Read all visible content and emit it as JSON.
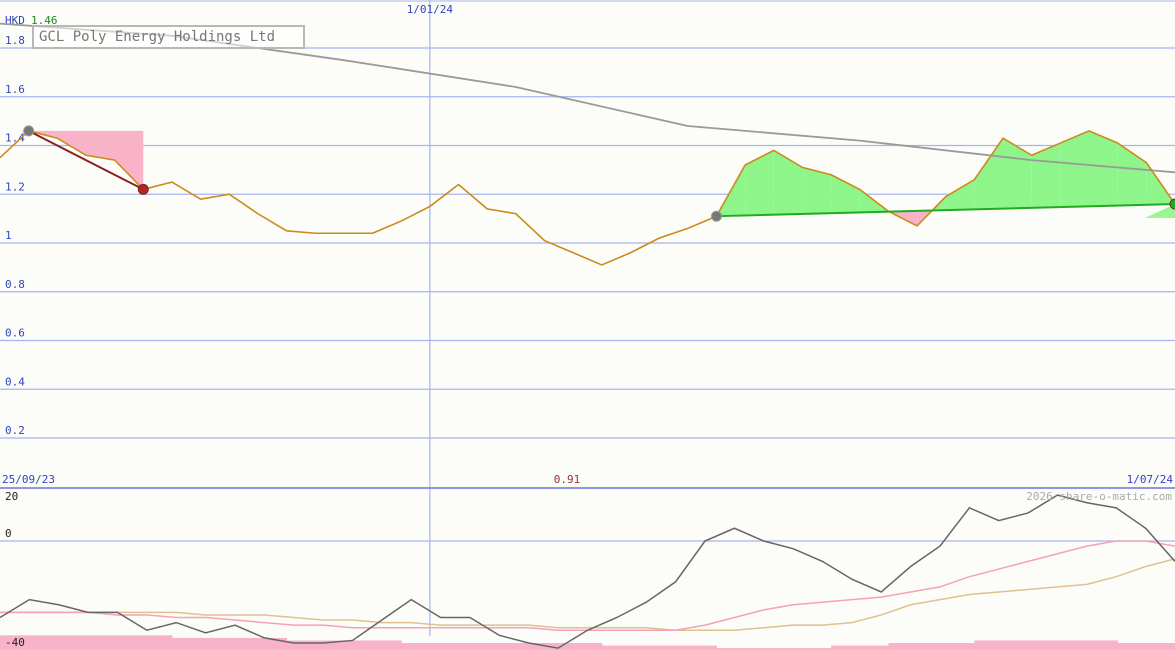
{
  "header": {
    "currency": "HKD",
    "last_price": "1.46",
    "company": "GCL Poly Energy Holdings Ltd",
    "watermark": "2026 share-o-matic.com"
  },
  "colors": {
    "price_line": "#cc8a1a",
    "trend_line": "#9a9a9a",
    "gain_fill": "#8ef58a",
    "loss_fill": "#f9b3c8",
    "gain_trend": "#22aa22",
    "loss_trend": "#882222",
    "grid": "#a5b4f0",
    "axis_text": "#3344bb"
  },
  "chart_data": [
    {
      "type": "line",
      "title": "GCL Poly Energy Holdings Ltd",
      "ylabel": "HKD",
      "ylim": [
        0,
        1.9
      ],
      "y_ticks": [
        "1.8",
        "1.6",
        "1.4",
        "1.2",
        "1",
        "0.8",
        "0.6",
        "0.4",
        "0.2"
      ],
      "x_labels": [
        "25/09/23",
        "1/01/24",
        "1/07/24"
      ],
      "min_label": "0.91",
      "grid": true,
      "series": [
        {
          "kind": "price",
          "x": [
            "2023-09-18",
            "2023-09-25",
            "2023-10-02",
            "2023-10-09",
            "2023-10-16",
            "2023-10-23",
            "2023-10-30",
            "2023-11-06",
            "2023-11-13",
            "2023-11-20",
            "2023-11-27",
            "2023-12-04",
            "2023-12-11",
            "2023-12-18",
            "2023-12-25",
            "2024-01-01",
            "2024-01-08",
            "2024-01-15",
            "2024-01-22",
            "2024-01-29",
            "2024-02-05",
            "2024-02-12",
            "2024-02-19",
            "2024-02-26",
            "2024-03-04",
            "2024-03-11",
            "2024-03-18",
            "2024-03-25",
            "2024-04-01",
            "2024-04-08",
            "2024-04-15",
            "2024-04-22",
            "2024-04-29",
            "2024-05-06",
            "2024-05-13",
            "2024-05-20",
            "2024-05-27",
            "2024-06-03",
            "2024-06-10",
            "2024-06-17",
            "2024-06-24",
            "2024-07-01"
          ],
          "values": [
            1.35,
            1.46,
            1.43,
            1.36,
            1.34,
            1.22,
            1.25,
            1.18,
            1.2,
            1.12,
            1.05,
            1.04,
            1.04,
            1.04,
            1.09,
            1.15,
            1.24,
            1.14,
            1.12,
            1.01,
            0.96,
            0.91,
            0.96,
            1.02,
            1.06,
            1.11,
            1.32,
            1.38,
            1.31,
            1.28,
            1.22,
            1.13,
            1.07,
            1.19,
            1.26,
            1.43,
            1.36,
            1.41,
            1.46,
            1.41,
            1.33,
            1.16
          ]
        },
        {
          "kind": "trend",
          "x": [
            "2023-09-18",
            "2023-10-30",
            "2023-12-11",
            "2024-01-22",
            "2024-03-04",
            "2024-04-15",
            "2024-05-27",
            "2024-07-01"
          ],
          "values": [
            1.9,
            1.85,
            1.75,
            1.64,
            1.48,
            1.42,
            1.34,
            1.29
          ]
        }
      ],
      "signals": [
        {
          "from": "2023-09-25",
          "to": "2023-10-23",
          "from_value": 1.46,
          "to_value": 1.22,
          "result": "loss"
        },
        {
          "from": "2024-03-11",
          "to": "2024-07-01",
          "from_value": 1.11,
          "to_value": 1.16,
          "result": "gain"
        }
      ]
    },
    {
      "type": "line",
      "ylim": [
        -40,
        20
      ],
      "y_ticks": [
        "20",
        "0",
        "-40"
      ],
      "grid": true,
      "series": [
        {
          "kind": "oscillator",
          "values": [
            -30,
            -23,
            -25,
            -28,
            -28,
            -35,
            -32,
            -36,
            -33,
            -38,
            -40,
            -40,
            -39,
            -31,
            -23,
            -30,
            -30,
            -37,
            -40,
            -42,
            -35,
            -30,
            -24,
            -16,
            0,
            5,
            0,
            -3,
            -8,
            -15,
            -20,
            -10,
            -2,
            13,
            8,
            11,
            18,
            15,
            13,
            5,
            -8
          ]
        },
        {
          "kind": "signal-fast",
          "values": [
            -28,
            -28,
            -28,
            -28,
            -29,
            -29,
            -30,
            -30,
            -31,
            -32,
            -33,
            -33,
            -34,
            -34,
            -34,
            -34,
            -34,
            -34,
            -34,
            -35,
            -35,
            -35,
            -35,
            -35,
            -33,
            -30,
            -27,
            -25,
            -24,
            -23,
            -22,
            -20,
            -18,
            -14,
            -11,
            -8,
            -5,
            -2,
            0,
            0,
            -2
          ]
        },
        {
          "kind": "signal-slow",
          "values": [
            -28,
            -28,
            -28,
            -28,
            -28,
            -28,
            -28,
            -29,
            -29,
            -29,
            -30,
            -31,
            -31,
            -32,
            -32,
            -33,
            -33,
            -33,
            -33,
            -34,
            -34,
            -34,
            -34,
            -35,
            -35,
            -35,
            -34,
            -33,
            -33,
            -32,
            -29,
            -25,
            -23,
            -21,
            -20,
            -19,
            -18,
            -17,
            -14,
            -10,
            -7
          ]
        },
        {
          "kind": "histogram",
          "values": [
            -37,
            -37,
            -37,
            -37,
            -37,
            -37,
            -38,
            -38,
            -38,
            -38,
            -39,
            -39,
            -39,
            -39,
            -40,
            -40,
            -40,
            -40,
            -40,
            -40,
            -40,
            -41,
            -41,
            -41,
            -41,
            -42,
            -42,
            -42,
            -42,
            -41,
            -41,
            -40,
            -40,
            -40,
            -39,
            -39,
            -39,
            -39,
            -39,
            -40,
            -40
          ]
        }
      ]
    }
  ]
}
